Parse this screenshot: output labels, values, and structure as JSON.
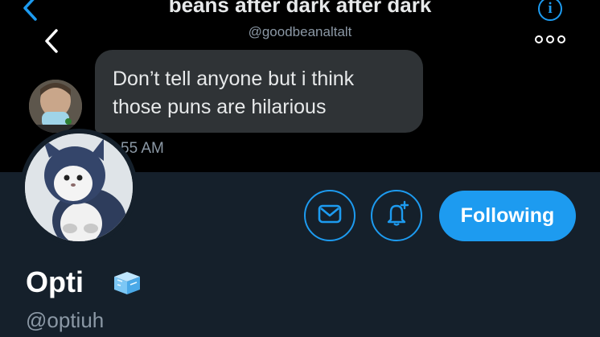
{
  "conversation": {
    "title": "beans after dark after dark",
    "handle": "@goodbeanaltalt",
    "info_icon": "info-icon",
    "more_icon": "more-horizontal-icon",
    "back_icon": "chevron-left-icon"
  },
  "message": {
    "text": "Don’t tell anyone but i think those puns are hilarious",
    "time": "55 AM"
  },
  "profile": {
    "display_name": "Opti",
    "username": "@optiuh",
    "name_badge_icon": "ice-cube-emoji",
    "buttons": {
      "message_icon": "envelope-icon",
      "notify_icon": "bell-plus-icon",
      "follow_label": "Following"
    }
  },
  "colors": {
    "accent": "#1d9bf0",
    "dm_background": "#000000",
    "profile_background": "#15202b",
    "bubble": "#2f3336",
    "secondary_text": "#8b98a5"
  }
}
